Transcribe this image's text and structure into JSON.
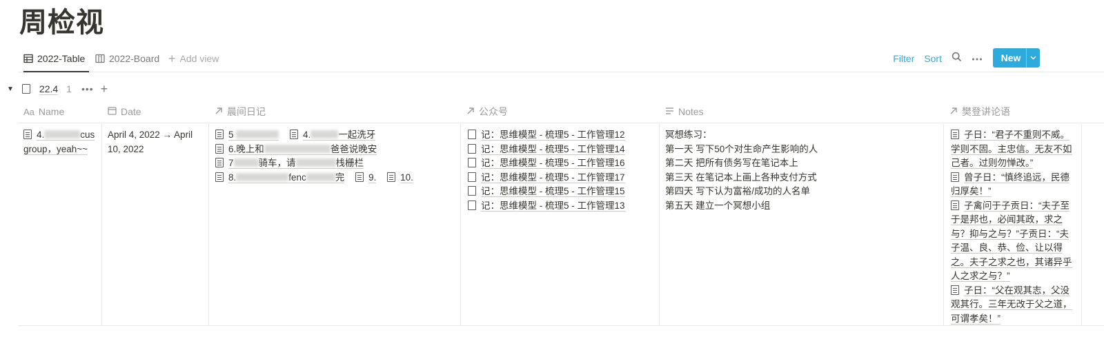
{
  "page": {
    "title": "周检视"
  },
  "views": {
    "tabs": [
      {
        "label": "2022-Table",
        "icon": "table-icon",
        "active": true
      },
      {
        "label": "2022-Board",
        "icon": "board-icon",
        "active": false
      }
    ],
    "add_view_label": "Add view"
  },
  "actions": {
    "filter_label": "Filter",
    "sort_label": "Sort",
    "search_icon": "search-icon",
    "more_icon": "more-icon",
    "new_label": "New",
    "accent_color": "#2eaadc"
  },
  "group": {
    "name": "22.4",
    "count": "1"
  },
  "columns": [
    {
      "label": "Name",
      "icon": "text-type-icon"
    },
    {
      "label": "Date",
      "icon": "calendar-icon"
    },
    {
      "label": "晨间日记",
      "icon": "relation-arrow-icon"
    },
    {
      "label": "公众号",
      "icon": "relation-arrow-icon"
    },
    {
      "label": "Notes",
      "icon": "text-lines-icon"
    },
    {
      "label": "樊登讲论语",
      "icon": "relation-arrow-icon"
    }
  ],
  "row": {
    "name_parts": [
      "4.",
      "cus",
      "group，yeah~~"
    ],
    "date": "April 4, 2022 → April 10, 2022",
    "morning_diary": {
      "line1": [
        "5",
        "4.",
        "一起洗牙"
      ],
      "line2": [
        "6.晚上和",
        "爸爸说晚安"
      ],
      "line3": [
        "7",
        "骑车，请",
        "栈栅栏"
      ],
      "line4": [
        "8.",
        "fenc",
        "完",
        "9.",
        "10."
      ]
    },
    "wechat": [
      "记：思维模型 - 梳理5 - 工作管理12",
      "记：思维模型 - 梳理5 - 工作管理14",
      "记：思维模型 - 梳理5 - 工作管理16",
      "记：思维模型 - 梳理5 - 工作管理17",
      "记：思维模型 - 梳理5 - 工作管理15",
      "记：思维模型 - 梳理5 - 工作管理13"
    ],
    "notes": [
      "冥想练习：",
      "第一天 写下50个对生命产生影响的人",
      "第二天 把所有债务写在笔记本上",
      "第三天 在笔记本上画上各种支付方式",
      "第四天 写下认为富裕/成功的人名单",
      "第五天 建立一个冥想小组"
    ],
    "analects": [
      "子日：“君子不重则不威。学则不固。主忠信。无友不如己者。过则勿惮改。”",
      "曾子日：“慎终追远，民德归厚矣！”",
      "子禽问于子贡日：“夫子至于是邦也，必闻其政，求之与？抑与之与？”子贡日：“夫子温、良、恭、俭、让以得之。夫子之求之也，其诸异乎人之求之与？”",
      "子日：“父在观其志，父没观其行。三年无改于父之道，可谓孝矣！”"
    ]
  }
}
